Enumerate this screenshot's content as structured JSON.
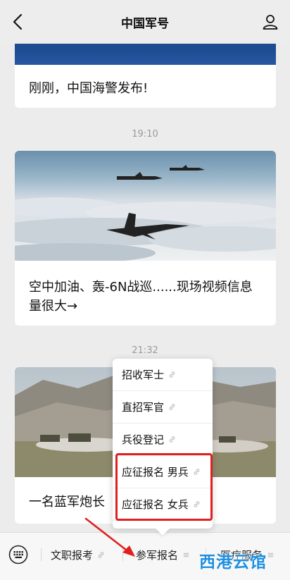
{
  "header": {
    "title": "中国军号"
  },
  "feed": {
    "card1_headline": "刚刚，中国海警发布!",
    "time1": "19:10",
    "card2_headline": "空中加油、轰-6N战巡......现场视频信息量很大→",
    "time2": "21:32",
    "card3_headline": "一名蓝军炮长"
  },
  "popup": {
    "items": [
      {
        "label": "招收军士"
      },
      {
        "label": "直招军官"
      },
      {
        "label": "兵役登记"
      },
      {
        "label": "应征报名 男兵"
      },
      {
        "label": "应征报名 女兵"
      }
    ]
  },
  "bottom_menu": [
    {
      "label": "文职报考"
    },
    {
      "label": "参军报名"
    },
    {
      "label": "医疗服务"
    }
  ],
  "watermark": "西港云馆",
  "colors": {
    "highlight": "#e02020",
    "arrow": "#e02020",
    "watermark": "#1e8fe0"
  }
}
